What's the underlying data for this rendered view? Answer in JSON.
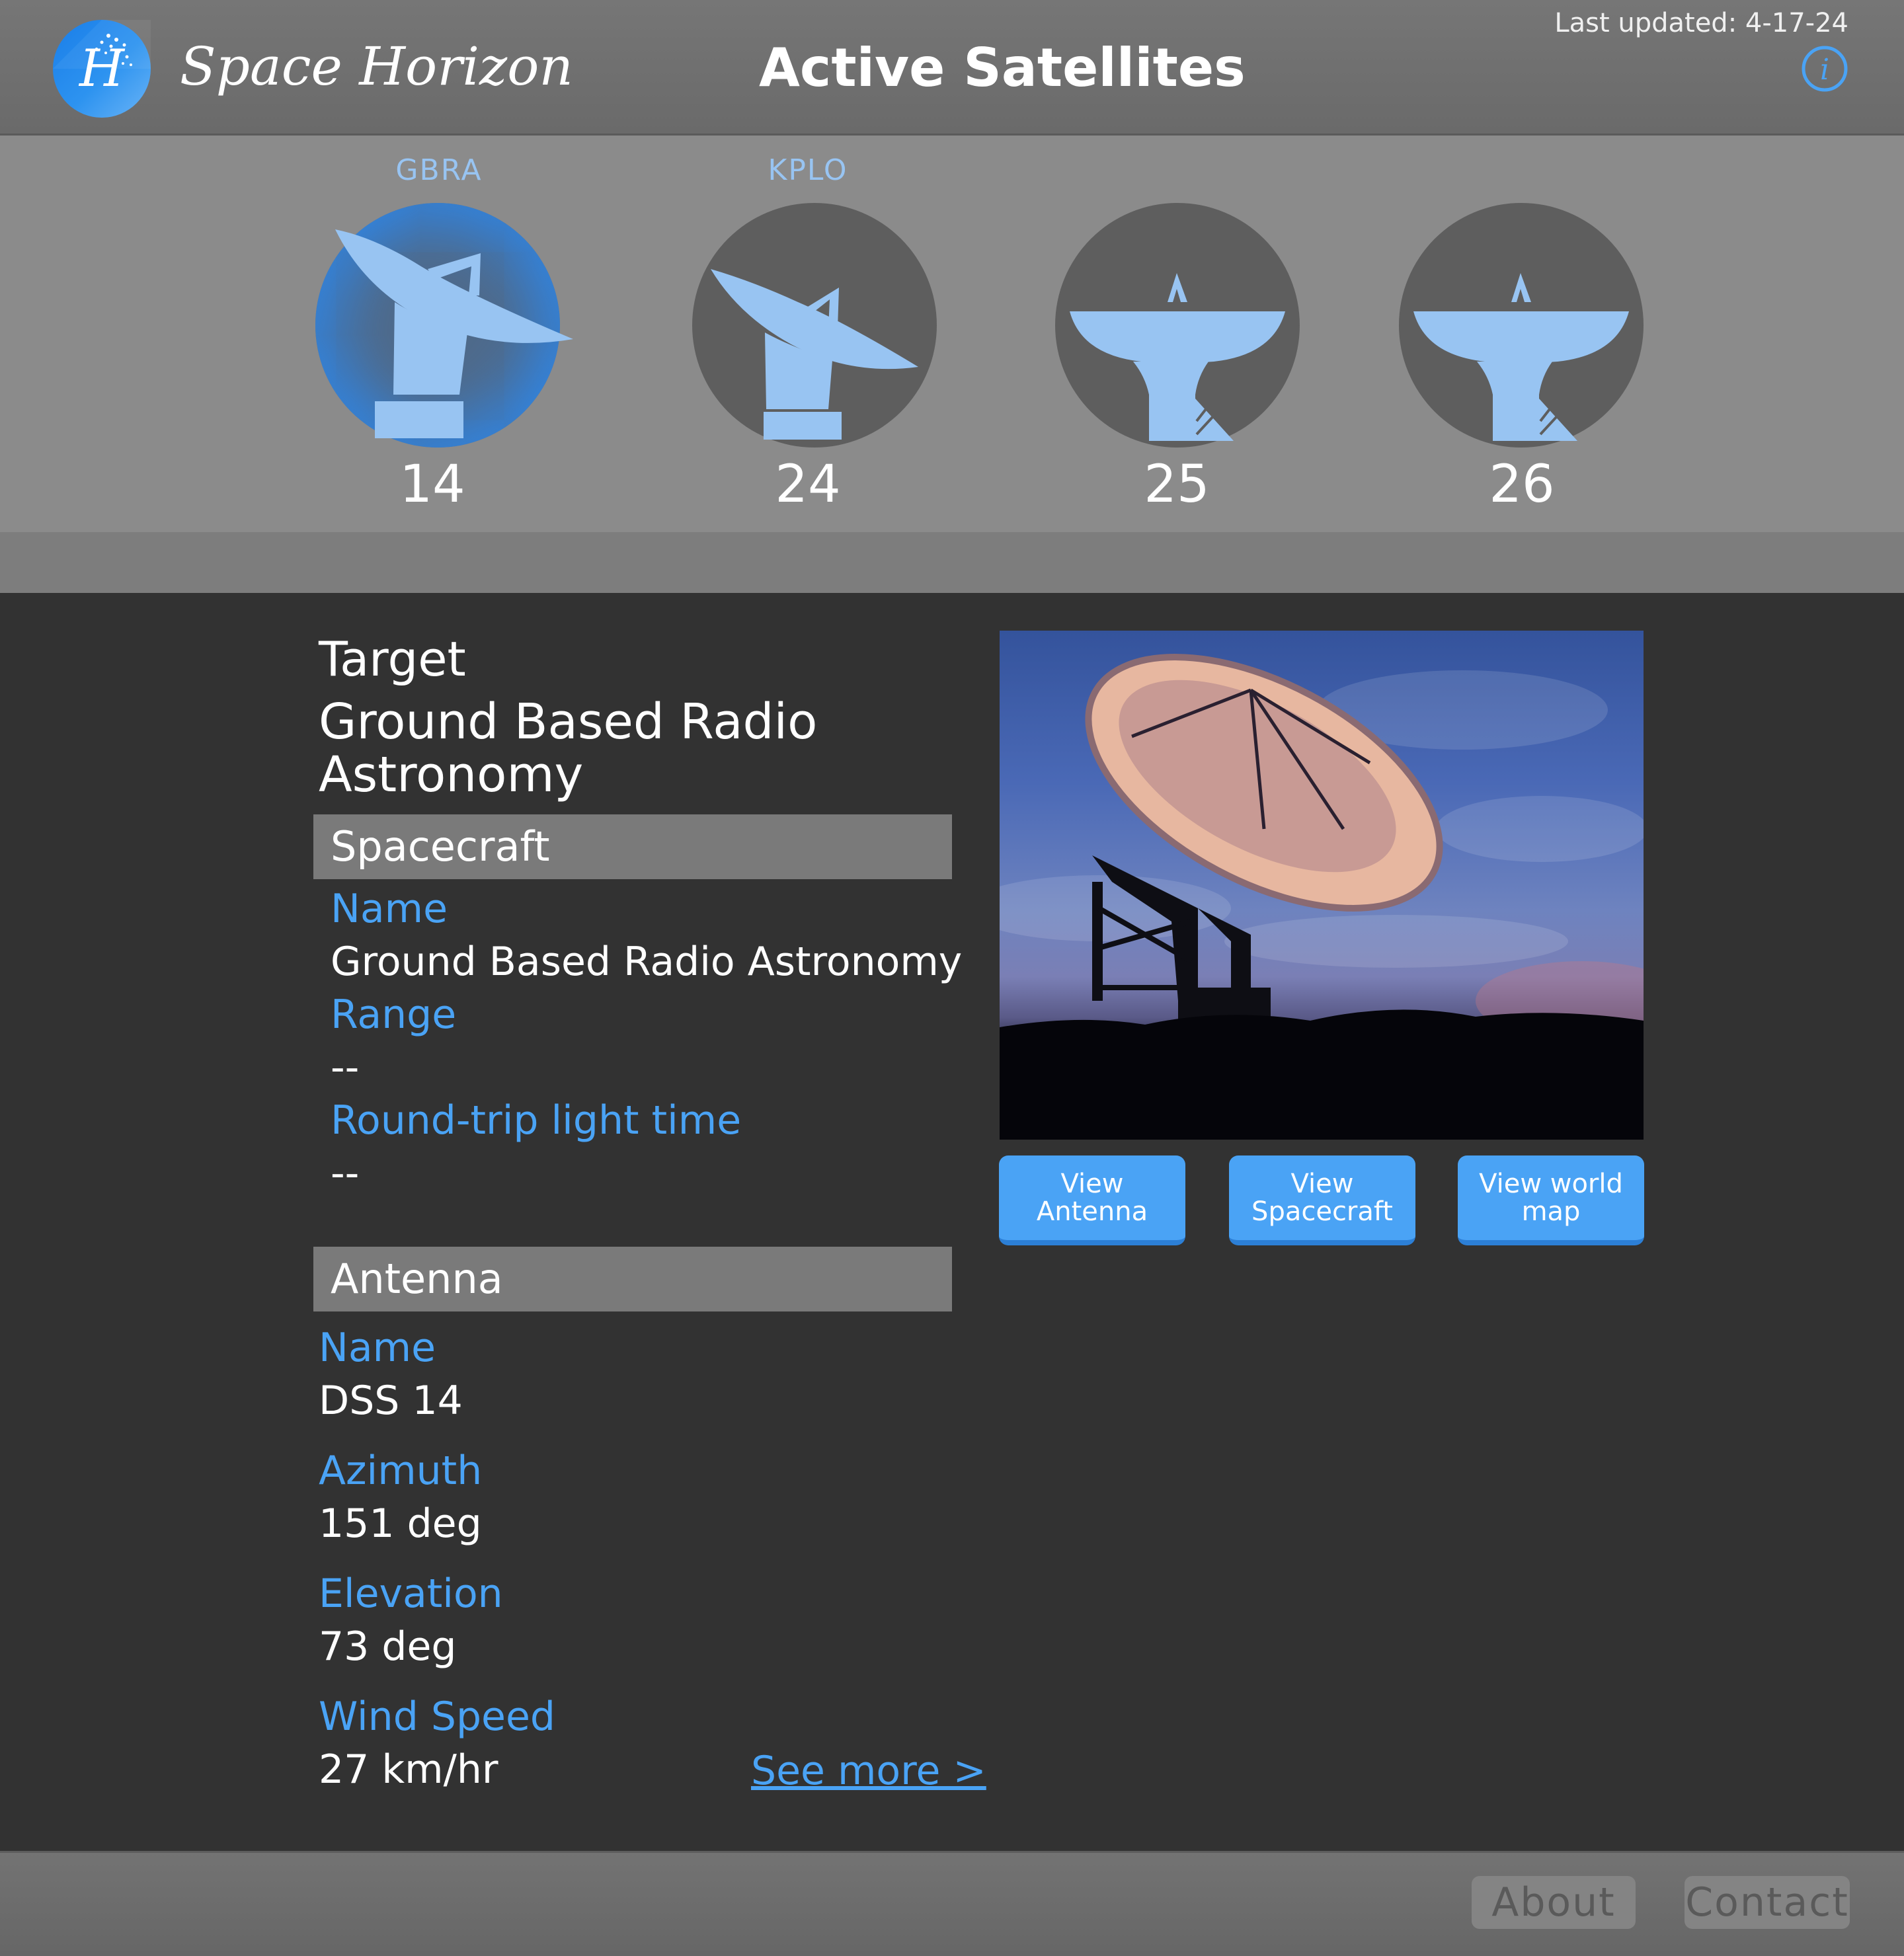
{
  "header": {
    "brand_letter": "H",
    "brand_name": "Space Horizon",
    "page_title": "Active Satellites",
    "last_updated": "Last updated: 4-17-24",
    "info_icon": "info-icon"
  },
  "antennas": [
    {
      "label": "GBRA",
      "number": "14",
      "active": true,
      "icon": "dish-antenna-icon"
    },
    {
      "label": "KPLO",
      "number": "24",
      "active": false,
      "icon": "dish-antenna-icon"
    },
    {
      "label": "",
      "number": "25",
      "active": false,
      "icon": "dish-antenna-icon"
    },
    {
      "label": "",
      "number": "26",
      "active": false,
      "icon": "dish-antenna-icon"
    }
  ],
  "target": {
    "heading": "Target",
    "name": "Ground Based Radio Astronomy"
  },
  "spacecraft": {
    "title": "Spacecraft",
    "name_label": "Name",
    "name_value": "Ground Based Radio Astronomy",
    "range_label": "Range",
    "range_value": "--",
    "rtlt_label": "Round-trip light time",
    "rtlt_value": "--"
  },
  "antenna_info": {
    "title": "Antenna",
    "name_label": "Name",
    "name_value": "DSS 14",
    "azimuth_label": "Azimuth",
    "azimuth_value": "151 deg",
    "elevation_label": "Elevation",
    "elevation_value": "73 deg",
    "wind_label": "Wind Speed",
    "wind_value": "27 km/hr",
    "see_more": "See more >"
  },
  "actions": {
    "view_antenna": "View Antenna",
    "view_spacecraft": "View Spacecraft",
    "view_world_map": "View world map"
  },
  "footer": {
    "about": "About",
    "contact": "Contact"
  },
  "colors": {
    "accent": "#4aa3f5",
    "dish": "#98c4f2",
    "header_bg": "#767676",
    "panel_bg": "#323232"
  }
}
